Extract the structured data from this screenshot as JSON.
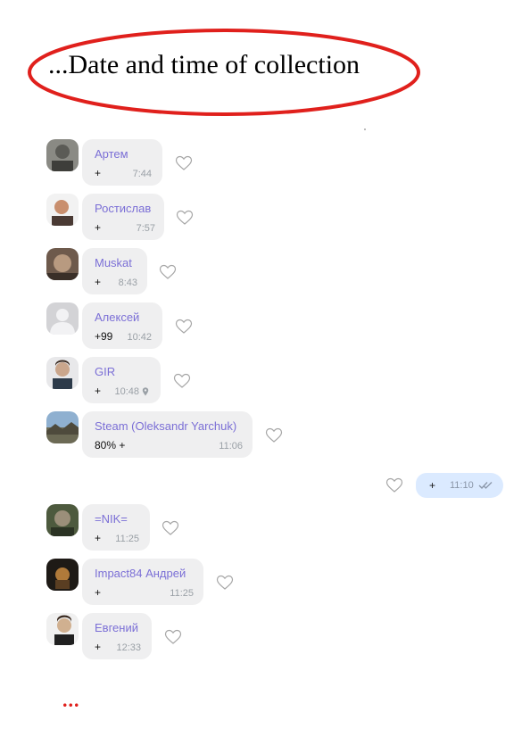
{
  "annotation": {
    "title": "...Date and time of collection",
    "ellipsis": "..."
  },
  "colors": {
    "annotation_red": "#e0201c",
    "sender_name": "#7b6fd6",
    "incoming_bubble": "#efeff0",
    "outgoing_bubble": "#dbeaff",
    "time_gray": "#9aa0a6"
  },
  "messages": [
    {
      "name": "Артем",
      "text": "+",
      "time": "7:44",
      "avatar": "avatar-photo-icon"
    },
    {
      "name": "Ростислав",
      "text": "+",
      "time": "7:57",
      "avatar": "avatar-photo-icon"
    },
    {
      "name": "Muskat",
      "text": "+",
      "time": "8:43",
      "avatar": "avatar-photo-icon"
    },
    {
      "name": "Алексей",
      "text": "+99",
      "time": "10:42",
      "avatar": "default-user-icon"
    },
    {
      "name": "GIR",
      "text": "+",
      "time": "10:48",
      "avatar": "avatar-photo-icon",
      "location_icon": "location-pin-icon"
    },
    {
      "name": "Steam (Oleksandr Yarchuk)",
      "text": "80% +",
      "time": "11:06",
      "avatar": "avatar-photo-icon"
    },
    {
      "name": "=NIK=",
      "text": "+",
      "time": "11:25",
      "avatar": "avatar-photo-icon"
    },
    {
      "name": "Impact84 Андрей",
      "text": "+",
      "time": "11:25",
      "avatar": "avatar-photo-icon"
    },
    {
      "name": "Евгений",
      "text": "+",
      "time": "12:33",
      "avatar": "avatar-photo-icon"
    }
  ],
  "outgoing": {
    "text": "+",
    "time": "11:10",
    "status_icon": "double-check-icon"
  }
}
